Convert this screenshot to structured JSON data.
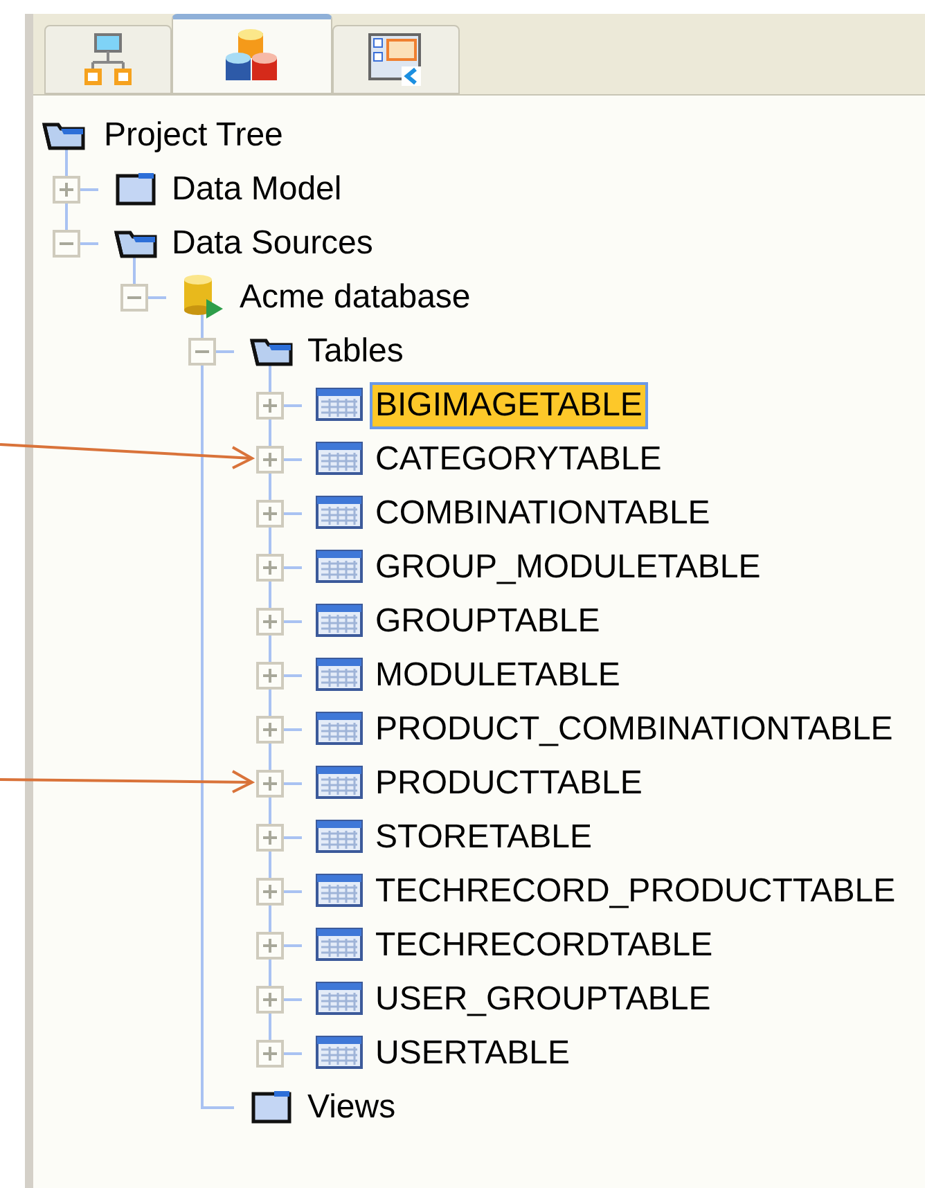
{
  "tabs": [
    {
      "kind": "diagram",
      "selected": false
    },
    {
      "kind": "database",
      "selected": true
    },
    {
      "kind": "layout",
      "selected": false
    }
  ],
  "tree": [
    {
      "label": "Project Tree",
      "kind": "folder",
      "selected": false,
      "children": [
        {
          "label": "Data Model",
          "kind": "folder",
          "expanded": false,
          "selected": false
        },
        {
          "label": "Data Sources",
          "kind": "folder",
          "expanded": true,
          "selected": false,
          "children": [
            {
              "label": "Acme database",
              "kind": "database",
              "expanded": true,
              "selected": false,
              "children": [
                {
                  "label": "Tables",
                  "kind": "folder",
                  "expanded": true,
                  "selected": false,
                  "children": [
                    {
                      "label": "BIGIMAGETABLE",
                      "kind": "table",
                      "expanded": false,
                      "selected": true,
                      "pointed": false
                    },
                    {
                      "label": "CATEGORYTABLE",
                      "kind": "table",
                      "expanded": false,
                      "selected": false,
                      "pointed": true
                    },
                    {
                      "label": "COMBINATIONTABLE",
                      "kind": "table",
                      "expanded": false,
                      "selected": false,
                      "pointed": false
                    },
                    {
                      "label": "GROUP_MODULETABLE",
                      "kind": "table",
                      "expanded": false,
                      "selected": false,
                      "pointed": false
                    },
                    {
                      "label": "GROUPTABLE",
                      "kind": "table",
                      "expanded": false,
                      "selected": false,
                      "pointed": false
                    },
                    {
                      "label": "MODULETABLE",
                      "kind": "table",
                      "expanded": false,
                      "selected": false,
                      "pointed": false
                    },
                    {
                      "label": "PRODUCT_COMBINATIONTABLE",
                      "kind": "table",
                      "expanded": false,
                      "selected": false,
                      "pointed": false
                    },
                    {
                      "label": "PRODUCTTABLE",
                      "kind": "table",
                      "expanded": false,
                      "selected": false,
                      "pointed": true
                    },
                    {
                      "label": "STORETABLE",
                      "kind": "table",
                      "expanded": false,
                      "selected": false,
                      "pointed": false
                    },
                    {
                      "label": "TECHRECORD_PRODUCTTABLE",
                      "kind": "table",
                      "expanded": false,
                      "selected": false,
                      "pointed": false
                    },
                    {
                      "label": "TECHRECORDTABLE",
                      "kind": "table",
                      "expanded": false,
                      "selected": false,
                      "pointed": false
                    },
                    {
                      "label": "USER_GROUPTABLE",
                      "kind": "table",
                      "expanded": false,
                      "selected": false,
                      "pointed": false
                    },
                    {
                      "label": "USERTABLE",
                      "kind": "table",
                      "expanded": false,
                      "selected": false,
                      "pointed": false
                    }
                  ]
                },
                {
                  "label": "Views",
                  "kind": "folder",
                  "selected": false
                }
              ]
            }
          ]
        }
      ]
    }
  ]
}
